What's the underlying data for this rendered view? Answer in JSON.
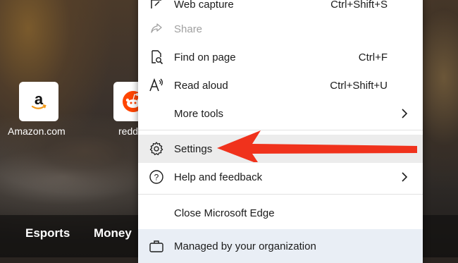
{
  "new_tab": {
    "quick_links": [
      {
        "label": "Amazon.com",
        "icon": "amazon-logo-icon"
      },
      {
        "label": "redd",
        "icon": "reddit-logo-icon"
      }
    ],
    "nav": [
      "Esports",
      "Money"
    ]
  },
  "menu": {
    "items": [
      {
        "label": "Web capture",
        "shortcut": "Ctrl+Shift+S",
        "icon": "web-capture-icon"
      },
      {
        "label": "Share",
        "icon": "share-icon",
        "disabled": true
      },
      {
        "label": "Find on page",
        "shortcut": "Ctrl+F",
        "icon": "find-on-page-icon"
      },
      {
        "label": "Read aloud",
        "shortcut": "Ctrl+Shift+U",
        "icon": "read-aloud-icon"
      },
      {
        "label": "More tools",
        "icon": "none",
        "submenu": true
      },
      {
        "label": "Settings",
        "icon": "gear-icon"
      },
      {
        "label": "Help and feedback",
        "icon": "help-icon",
        "submenu": true
      },
      {
        "label": "Close Microsoft Edge"
      },
      {
        "label": "Managed by your organization",
        "icon": "briefcase-icon"
      }
    ]
  },
  "annotation": {
    "type": "arrow",
    "color": "#f0321c",
    "points_to": "Settings"
  }
}
